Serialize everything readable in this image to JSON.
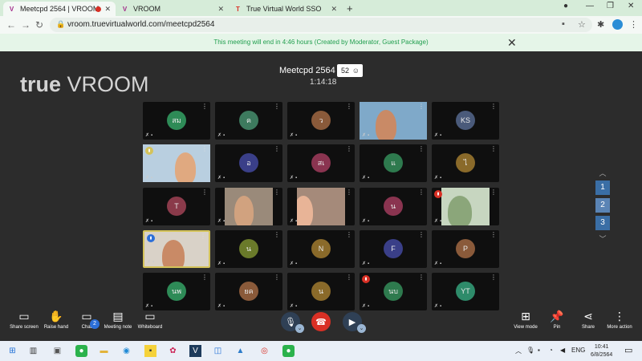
{
  "browser": {
    "tabs": [
      {
        "title": "Meetcpd 2564 | VROOM",
        "icon": "V"
      },
      {
        "title": "VROOM",
        "icon": "V"
      },
      {
        "title": "True Virtual World SSO",
        "icon": "T"
      }
    ],
    "url": "vroom.truevirtualworld.com/meetcpd2564"
  },
  "notice": {
    "text": "This meeting will end in 4:46 hours (Created by Moderator, Guest Package)"
  },
  "meeting": {
    "logo_a": "true",
    "logo_b": "VROOM",
    "title": "Meetcpd 2564",
    "participant_count": "52",
    "elapsed": "1:14:18"
  },
  "participants": [
    {
      "initials": "สม",
      "color": "#2e8b57"
    },
    {
      "initials": "ค",
      "color": "#3d7a5e"
    },
    {
      "initials": "ว",
      "color": "#8a5a3a"
    },
    {
      "initials": "",
      "video": true
    },
    {
      "initials": "KS",
      "color": "#4a5a7a"
    },
    {
      "initials": "",
      "video": true
    },
    {
      "initials": "อ",
      "color": "#3a3f88"
    },
    {
      "initials": "สเ",
      "color": "#8a3450"
    },
    {
      "initials": "แ",
      "color": "#2e7a4e"
    },
    {
      "initials": "ไ",
      "color": "#8a6a2a"
    },
    {
      "initials": "T",
      "color": "#8a3a4a"
    },
    {
      "initials": "",
      "video": true
    },
    {
      "initials": "",
      "video": true
    },
    {
      "initials": "น",
      "color": "#8a3450"
    },
    {
      "initials": "",
      "video": true
    },
    {
      "initials": "",
      "video": true
    },
    {
      "initials": "น",
      "color": "#6a7a2a"
    },
    {
      "initials": "N",
      "color": "#8a6a2a"
    },
    {
      "initials": "F",
      "color": "#3a3f88"
    },
    {
      "initials": "P",
      "color": "#8a5a3a"
    },
    {
      "initials": "นพ",
      "color": "#2e8b57"
    },
    {
      "initials": "ยค",
      "color": "#8a5a3a"
    },
    {
      "initials": "น",
      "color": "#8a6a2a"
    },
    {
      "initials": "นบ",
      "color": "#2e7a4e"
    },
    {
      "initials": "YT",
      "color": "#2e8b6a"
    }
  ],
  "pager": {
    "pages": [
      "1",
      "2",
      "3"
    ],
    "current": "2"
  },
  "controls": {
    "share_screen": "Share screen",
    "raise_hand": "Raise hand",
    "chat": "Chat",
    "chat_badge": "2",
    "meeting_note": "Meeting note",
    "whiteboard": "Whiteboard",
    "view_mode": "View mode",
    "pin": "Pin",
    "share": "Share",
    "more_action": "More action"
  },
  "taskbar": {
    "language": "ENG",
    "time": "10:41",
    "date": "6/8/2564"
  }
}
